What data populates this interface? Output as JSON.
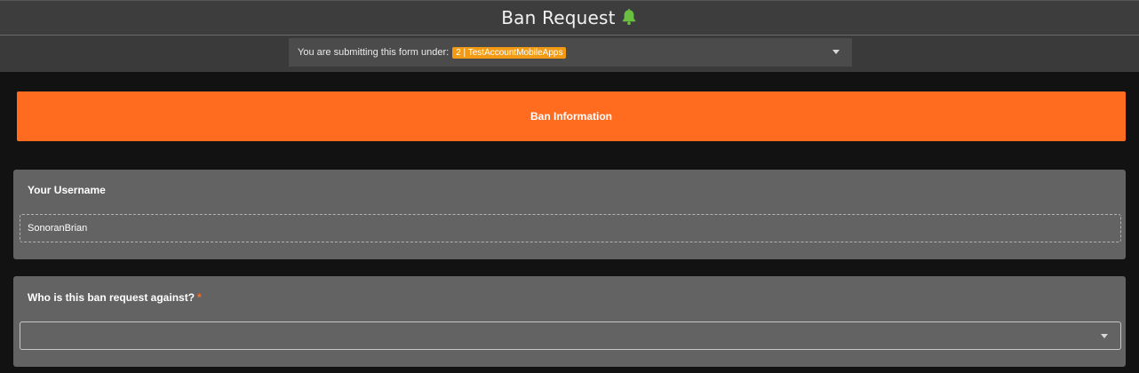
{
  "header": {
    "title": "Ban Request",
    "icon": "bell-icon",
    "icon_color": "#6abf40"
  },
  "account_selector": {
    "prefix": "You are submitting this form under:",
    "badge": "2 | TestAccountMobileApps",
    "badge_color": "#f29a14"
  },
  "section": {
    "title": "Ban Information",
    "color": "#ff6b1f"
  },
  "fields": {
    "username": {
      "label": "Your Username",
      "value": "SonoranBrian"
    },
    "target": {
      "label": "Who is this ban request against?",
      "required_marker": "*",
      "value": ""
    }
  }
}
